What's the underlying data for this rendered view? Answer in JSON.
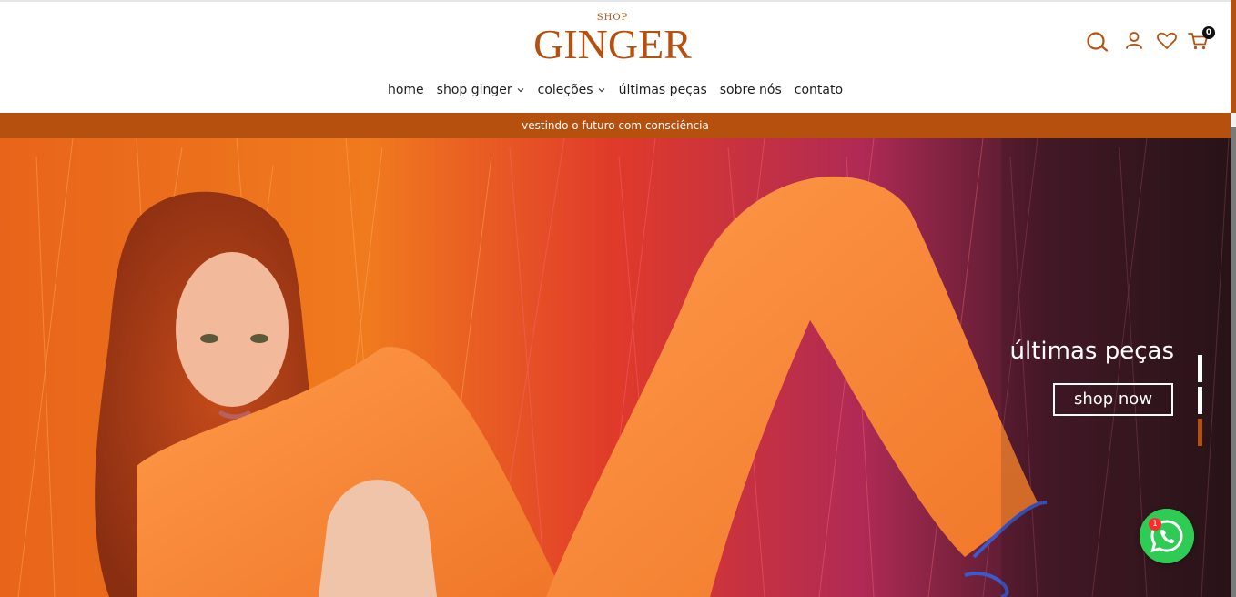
{
  "brand": {
    "small": "SHOP",
    "name": "GINGER",
    "color": "#b5500f"
  },
  "header_icons": {
    "search": "search-icon",
    "account": "user-icon",
    "wishlist": "heart-icon",
    "cart": "cart-icon",
    "cart_count": "0"
  },
  "nav": {
    "items": [
      {
        "label": "home",
        "dropdown": false
      },
      {
        "label": "shop ginger",
        "dropdown": true
      },
      {
        "label": "coleções",
        "dropdown": true
      },
      {
        "label": "últimas peças",
        "dropdown": false
      },
      {
        "label": "sobre nós",
        "dropdown": false
      },
      {
        "label": "contato",
        "dropdown": false
      }
    ]
  },
  "announcement": {
    "text": "vestindo o futuro com consciência",
    "background": "#b5500f"
  },
  "hero": {
    "title": "últimas peças",
    "button": "shop now",
    "slides": 3,
    "active_slide": 3
  },
  "whatsapp": {
    "icon": "whatsapp-icon",
    "badge": "1",
    "color": "#2ecc55"
  }
}
